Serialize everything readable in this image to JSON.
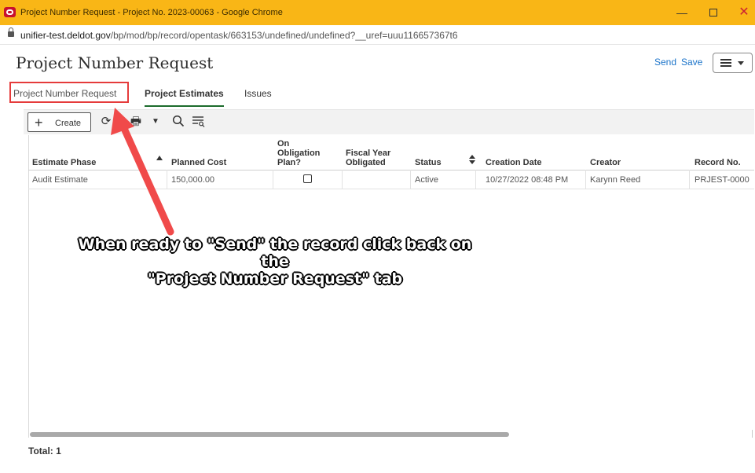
{
  "window": {
    "title": "Project Number Request - Project No. 2023-00063 - Google Chrome",
    "controls": {
      "minimize": "—",
      "maximize": "",
      "close": "✕"
    }
  },
  "address_bar": {
    "host": "unifier-test.deldot.gov",
    "path": "/bp/mod/bp/record/opentask/663153/undefined/undefined?__uref=uuu116657367t6"
  },
  "header": {
    "title": "Project Number Request",
    "send_label": "Send",
    "save_label": "Save"
  },
  "tabs": [
    {
      "label": "Project Number Request",
      "active": false
    },
    {
      "label": "Project Estimates",
      "active": true
    },
    {
      "label": "Issues",
      "active": false
    }
  ],
  "toolbar": {
    "create_label": "Create",
    "icons": [
      "refresh-icon",
      "print-icon",
      "dropdown-caret-icon",
      "search-icon",
      "filter-icon"
    ]
  },
  "table": {
    "columns": {
      "estimate_phase": "Estimate Phase",
      "planned_cost": "Planned Cost",
      "on_obligation_plan": [
        "On",
        "Obligation",
        "Plan?"
      ],
      "fiscal_year_obligated": [
        "Fiscal Year",
        "Obligated"
      ],
      "status": "Status",
      "creation_date": "Creation Date",
      "creator": "Creator",
      "record_no": "Record No."
    },
    "rows": [
      {
        "estimate_phase": "Audit Estimate",
        "planned_cost": "150,000.00",
        "on_obligation_plan": false,
        "fiscal_year_obligated": "",
        "status": "Active",
        "creation_date": "10/27/2022 08:48 PM",
        "creator": "Karynn Reed",
        "record_no": "PRJEST-0000"
      }
    ],
    "total_label": "Total: 1"
  },
  "annotation": {
    "line1": "When ready to \"Send\" the record click back on the",
    "line2": "\"Project Number Request\" tab",
    "color": "#e53b3b"
  }
}
